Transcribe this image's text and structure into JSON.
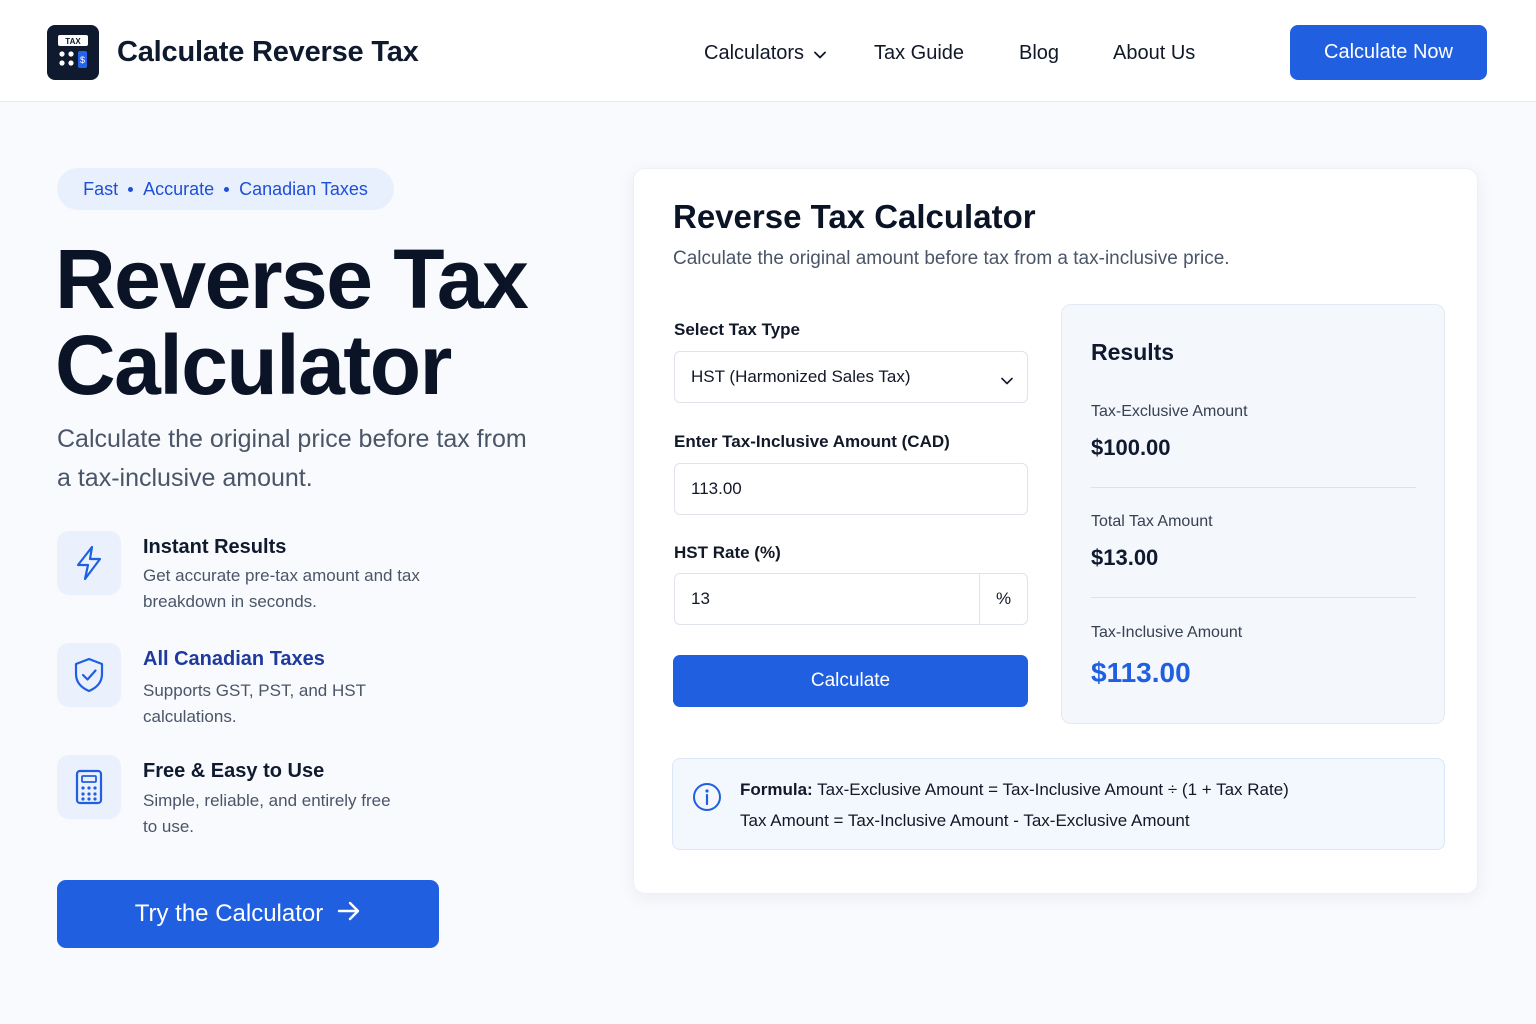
{
  "header": {
    "logo_tag": "TAX",
    "title": "Calculate Reverse Tax",
    "nav": [
      {
        "label": "Calculators"
      },
      {
        "label": "Tax Guide"
      },
      {
        "label": "Blog"
      },
      {
        "label": "About Us"
      }
    ],
    "cta_label": "Calculate Now"
  },
  "hero": {
    "badge": [
      "Fast",
      "Accurate",
      "Canadian Taxes"
    ],
    "title_line1": "Reverse Tax",
    "title_line2": "Calculator",
    "subtitle_line1": "Calculate the original price before tax from",
    "subtitle_line2": "a tax-inclusive amount.",
    "features": [
      {
        "icon": "lightning-icon",
        "title": "Instant Results",
        "desc_line1": "Get accurate pre-tax amount and tax",
        "desc_line2": "breakdown in seconds."
      },
      {
        "icon": "shield-check-icon",
        "title": "All Canadian Taxes",
        "desc_line1": "Supports GST, PST, and HST",
        "desc_line2": "calculations."
      },
      {
        "icon": "calculator-icon",
        "title": "Free & Easy to Use",
        "desc_line1": "Simple, reliable, and entirely free",
        "desc_line2": "to use."
      }
    ],
    "cta_label": "Try the Calculator"
  },
  "calculator": {
    "title": "Reverse Tax Calculator",
    "subtitle": "Calculate the original amount before tax from a tax-inclusive price.",
    "tax_type_label": "Select Tax Type",
    "tax_type_value": "HST (Harmonized Sales Tax)",
    "amount_label": "Enter Tax-Inclusive Amount (CAD)",
    "amount_value": "113.00",
    "rate_label": "HST Rate (%)",
    "rate_value": "13",
    "rate_suffix": "%",
    "button_label": "Calculate",
    "results": {
      "title": "Results",
      "exclusive_label": "Tax-Exclusive Amount",
      "exclusive_value": "$100.00",
      "tax_label": "Total Tax Amount",
      "tax_value": "$13.00",
      "inclusive_label": "Tax-Inclusive Amount",
      "inclusive_value": "$113.00"
    },
    "formula": {
      "prefix": "Formula:",
      "line1": "Tax-Exclusive Amount = Tax-Inclusive Amount ÷ (1 + Tax Rate)",
      "line2": "Tax Amount = Tax-Inclusive Amount - Tax-Exclusive Amount"
    }
  },
  "colors": {
    "accent": "#1f5fe0",
    "dark": "#0f1a2e",
    "feature_title_blue": "#1e3a9e"
  }
}
